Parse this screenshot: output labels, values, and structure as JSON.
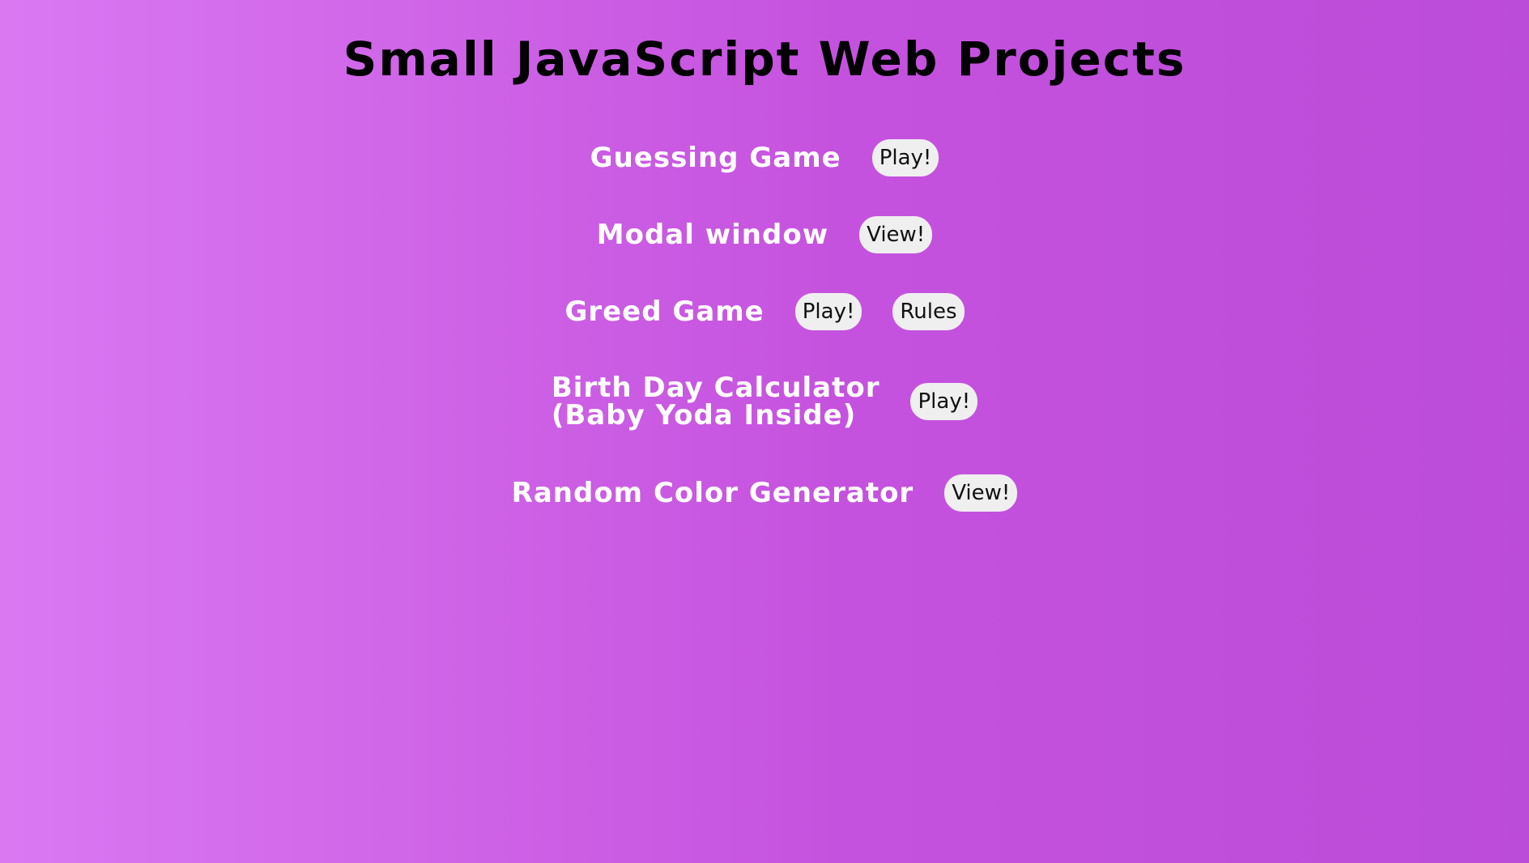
{
  "header": {
    "title": "Small JavaScript Web Projects"
  },
  "projects": [
    {
      "name_lines": [
        "Guessing Game"
      ],
      "buttons": [
        "Play!"
      ]
    },
    {
      "name_lines": [
        "Modal window"
      ],
      "buttons": [
        "View!"
      ]
    },
    {
      "name_lines": [
        "Greed Game"
      ],
      "buttons": [
        "Play!",
        "Rules"
      ]
    },
    {
      "name_lines": [
        "Birth Day Calculator",
        "(Baby Yoda Inside)"
      ],
      "buttons": [
        "Play!"
      ]
    },
    {
      "name_lines": [
        "Random Color Generator"
      ],
      "buttons": [
        "View!"
      ]
    }
  ],
  "colors": {
    "background_left": "#da78f2",
    "background_right": "#bb4cd9",
    "title": "#000000",
    "project_text": "#ffffff",
    "button_bg": "#efefef"
  }
}
